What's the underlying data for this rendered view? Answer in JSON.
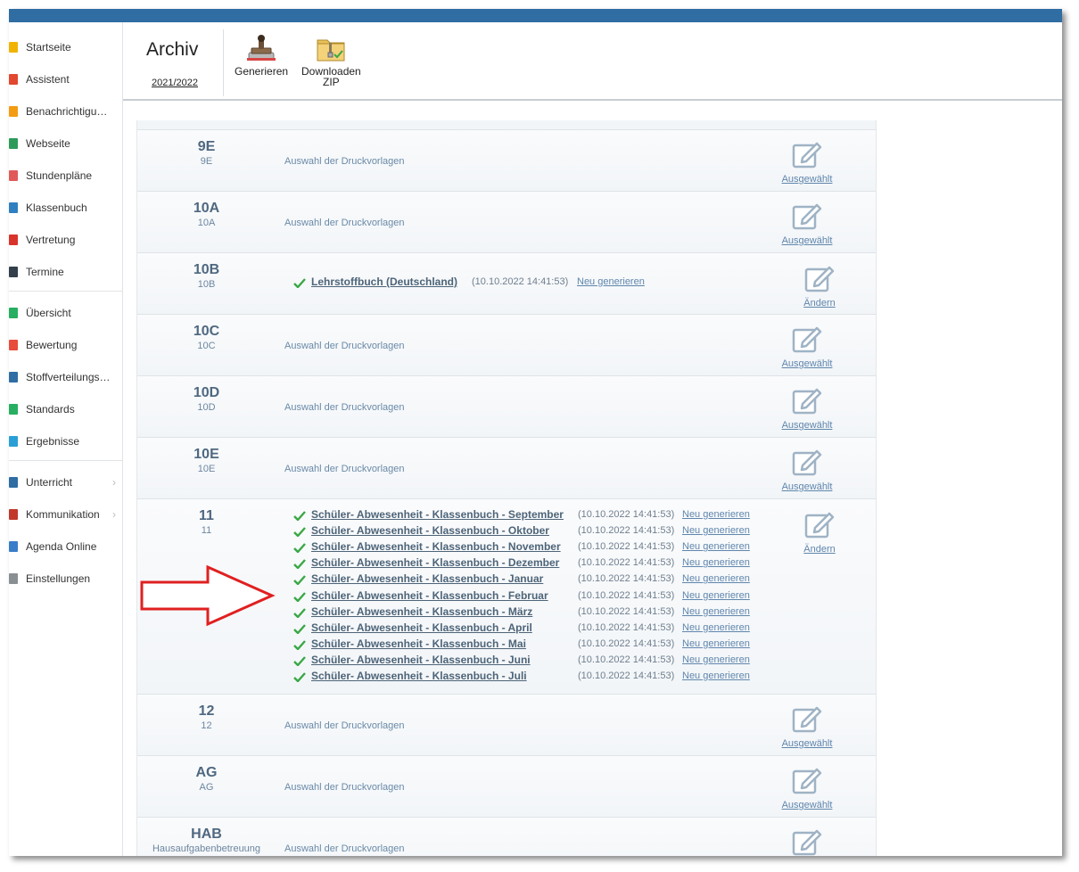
{
  "sidebar": {
    "items": [
      {
        "label": "Startseite",
        "color": "#f0b400"
      },
      {
        "label": "Assistent",
        "color": "#e2472f"
      },
      {
        "label": "Benachrichtigungen",
        "color": "#f39c12"
      },
      {
        "label": "Webseite",
        "color": "#2e9a5a"
      },
      {
        "label": "Stundenpläne",
        "color": "#e05a5a"
      },
      {
        "label": "Klassenbuch",
        "color": "#2f7fc1"
      },
      {
        "label": "Vertretung",
        "color": "#d9342b"
      },
      {
        "label": "Termine",
        "color": "#333f4a"
      },
      {
        "label": "Übersicht",
        "color": "#27ae60"
      },
      {
        "label": "Bewertung",
        "color": "#e74c3c"
      },
      {
        "label": "Stoffverteilungsplan",
        "color": "#2f6da3"
      },
      {
        "label": "Standards",
        "color": "#27ae60"
      },
      {
        "label": "Ergebnisse",
        "color": "#2a9fd6"
      },
      {
        "label": "Unterricht",
        "color": "#2f6da3"
      },
      {
        "label": "Kommunikation",
        "color": "#c0392b"
      },
      {
        "label": "Agenda Online",
        "color": "#3a7dc9"
      },
      {
        "label": "Einstellungen",
        "color": "#8a8f94"
      }
    ]
  },
  "toolbar": {
    "title": "Archiv",
    "year": "2021/2022",
    "generate_label": "Generieren",
    "download_label_1": "Downloaden",
    "download_label_2": "ZIP"
  },
  "labels": {
    "choose": "Auswahl der Druckvorlagen",
    "selected": "Ausgewählt",
    "change": "Ändern",
    "regenerate": "Neu generieren"
  },
  "rows": [
    {
      "name": "9E",
      "sub": "9E"
    },
    {
      "name": "10A",
      "sub": "10A"
    },
    {
      "name": "10B",
      "sub": "10B",
      "docs": [
        {
          "name": "Lehrstoffbuch (Deutschland)",
          "ts": "(10.10.2022 14:41:53)"
        }
      ]
    },
    {
      "name": "10C",
      "sub": "10C"
    },
    {
      "name": "10D",
      "sub": "10D"
    },
    {
      "name": "10E",
      "sub": "10E"
    },
    {
      "name": "11",
      "sub": "11",
      "docs": [
        {
          "name": "Schüler- Abwesenheit - Klassenbuch - September",
          "ts": "(10.10.2022 14:41:53)"
        },
        {
          "name": "Schüler- Abwesenheit - Klassenbuch - Oktober",
          "ts": "(10.10.2022 14:41:53)"
        },
        {
          "name": "Schüler- Abwesenheit - Klassenbuch - November",
          "ts": "(10.10.2022 14:41:53)"
        },
        {
          "name": "Schüler- Abwesenheit - Klassenbuch - Dezember",
          "ts": "(10.10.2022 14:41:53)"
        },
        {
          "name": "Schüler- Abwesenheit - Klassenbuch - Januar",
          "ts": "(10.10.2022 14:41:53)"
        },
        {
          "name": "Schüler- Abwesenheit - Klassenbuch - Februar",
          "ts": "(10.10.2022 14:41:53)"
        },
        {
          "name": "Schüler- Abwesenheit - Klassenbuch - März",
          "ts": "(10.10.2022 14:41:53)"
        },
        {
          "name": "Schüler- Abwesenheit - Klassenbuch - April",
          "ts": "(10.10.2022 14:41:53)"
        },
        {
          "name": "Schüler- Abwesenheit - Klassenbuch - Mai",
          "ts": "(10.10.2022 14:41:53)"
        },
        {
          "name": "Schüler- Abwesenheit - Klassenbuch - Juni",
          "ts": "(10.10.2022 14:41:53)"
        },
        {
          "name": "Schüler- Abwesenheit - Klassenbuch - Juli",
          "ts": "(10.10.2022 14:41:53)"
        }
      ]
    },
    {
      "name": "12",
      "sub": "12"
    },
    {
      "name": "AG",
      "sub": "AG"
    },
    {
      "name": "HAB",
      "sub": "Hausaufgabenbetreuung"
    }
  ],
  "colors": {
    "accent": "#2f6da3",
    "arrow": "#e02020",
    "check": "#3aa845"
  }
}
